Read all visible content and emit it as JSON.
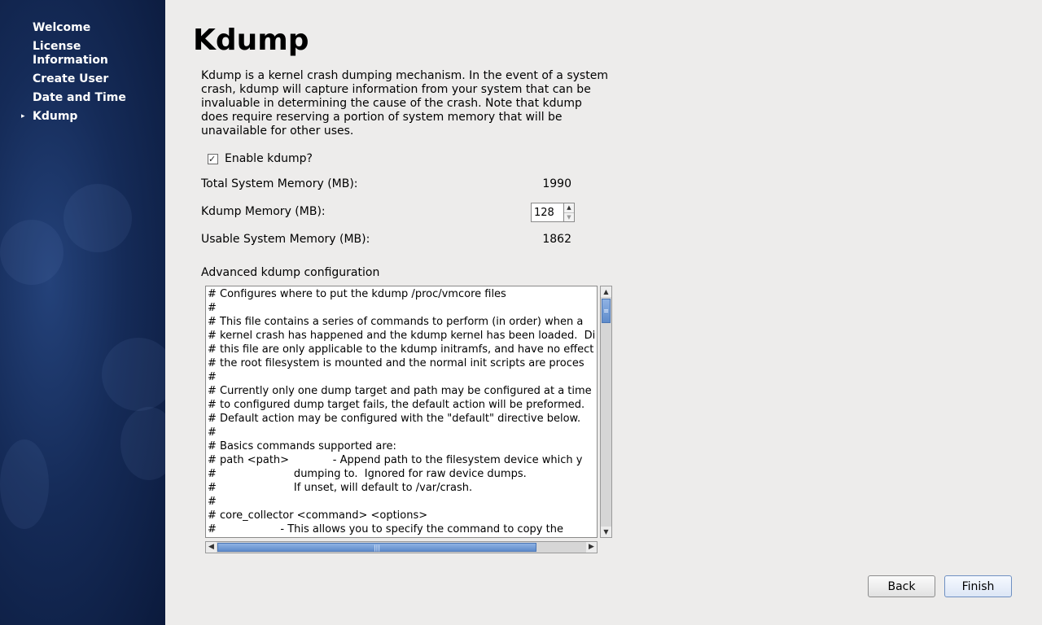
{
  "sidebar": {
    "items": [
      {
        "label": "Welcome",
        "active": false
      },
      {
        "label": "License\nInformation",
        "active": false
      },
      {
        "label": "Create User",
        "active": false
      },
      {
        "label": "Date and Time",
        "active": false
      },
      {
        "label": "Kdump",
        "active": true
      }
    ]
  },
  "page": {
    "title": "Kdump",
    "description": "Kdump is a kernel crash dumping mechanism. In the event of a system crash, kdump will capture information from your system that can be invaluable in determining the cause of the crash. Note that kdump does require reserving a portion of system memory that will be unavailable for other uses."
  },
  "enable": {
    "label": "Enable kdump?",
    "checked": true
  },
  "memory": {
    "total_label": "Total System Memory (MB):",
    "total_value": "1990",
    "kdump_label": "Kdump Memory (MB):",
    "kdump_value": "128",
    "usable_label": "Usable System Memory (MB):",
    "usable_value": "1862"
  },
  "advanced": {
    "label": "Advanced kdump configuration",
    "text": "# Configures where to put the kdump /proc/vmcore files\n#\n# This file contains a series of commands to perform (in order) when a\n# kernel crash has happened and the kdump kernel has been loaded.  Di\n# this file are only applicable to the kdump initramfs, and have no effect\n# the root filesystem is mounted and the normal init scripts are proces\n#\n# Currently only one dump target and path may be configured at a time\n# to configured dump target fails, the default action will be preformed.\n# Default action may be configured with the \"default\" directive below.\n#\n# Basics commands supported are:\n# path <path>             - Append path to the filesystem device which y\n#                       dumping to.  Ignored for raw device dumps.\n#                       If unset, will default to /var/crash.\n#\n# core_collector <command> <options>\n#                   - This allows you to specify the command to copy the\n#                       vmcore.  You could use the dump filtering"
  },
  "buttons": {
    "back": "Back",
    "finish": "Finish"
  },
  "colors": {
    "sidebar_bg": "#152b58",
    "content_bg": "#edeceb",
    "scroll_thumb": "#6d98d4"
  }
}
